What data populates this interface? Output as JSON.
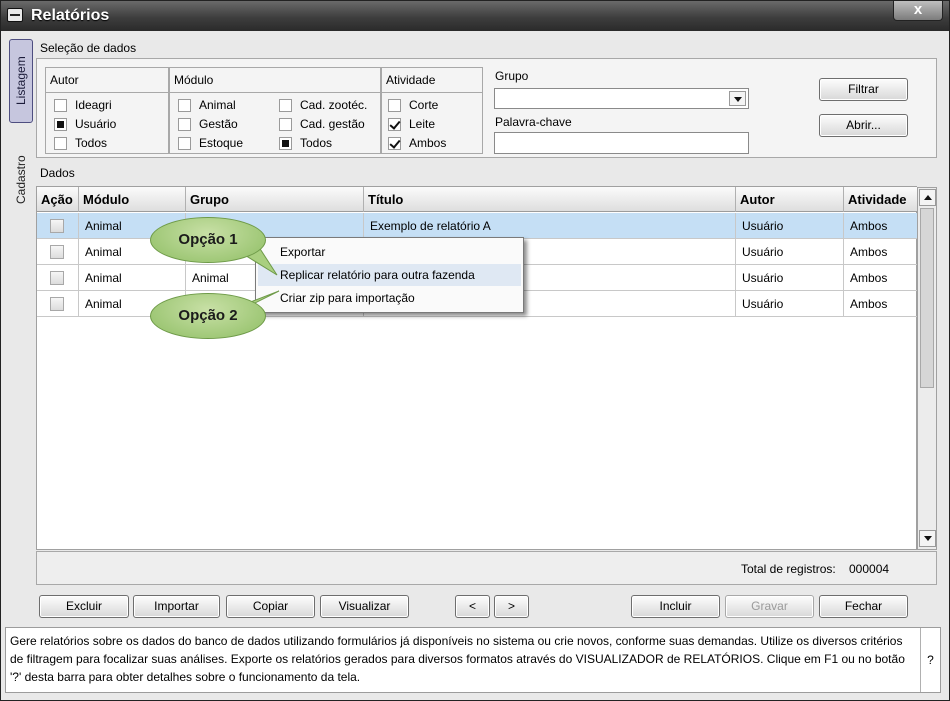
{
  "window": {
    "title": "Relatórios",
    "close_label": "x"
  },
  "side_tabs": {
    "active": "Listagem",
    "inactive": "Cadastro"
  },
  "selection": {
    "label": "Seleção de dados",
    "autor": {
      "title": "Autor",
      "options": [
        "Ideagri",
        "Usuário",
        "Todos"
      ]
    },
    "modulo": {
      "title": "Módulo",
      "col1": [
        "Animal",
        "Gestão",
        "Estoque"
      ],
      "col2": [
        "Cad. zootéc.",
        "Cad. gestão",
        "Todos"
      ]
    },
    "atividade": {
      "title": "Atividade",
      "options": [
        "Corte",
        "Leite",
        "Ambos"
      ]
    },
    "grupo_label": "Grupo",
    "grupo_value": "",
    "keyword_label": "Palavra-chave",
    "keyword_value": "",
    "filter_button": "Filtrar",
    "open_button": "Abrir..."
  },
  "data": {
    "label": "Dados",
    "columns": [
      "Ação",
      "Módulo",
      "Grupo",
      "Título",
      "Autor",
      "Atividade"
    ],
    "rows": [
      {
        "modulo": "Animal",
        "grupo": "",
        "titulo": "Exemplo de relatório A",
        "autor": "Usuário",
        "atividade": "Ambos"
      },
      {
        "modulo": "Animal",
        "grupo": "",
        "titulo": "",
        "autor": "Usuário",
        "atividade": "Ambos"
      },
      {
        "modulo": "Animal",
        "grupo": "Animal",
        "titulo": "",
        "autor": "Usuário",
        "atividade": "Ambos"
      },
      {
        "modulo": "Animal",
        "grupo": "",
        "titulo": "",
        "autor": "Usuário",
        "atividade": "Ambos"
      }
    ],
    "total_label": "Total de registros:",
    "total_value": "000004"
  },
  "context_menu": {
    "items": [
      "Exportar",
      "Replicar relatório para outra fazenda",
      "Criar zip para importação"
    ]
  },
  "callouts": {
    "option1": "Opção 1",
    "option2": "Opção 2"
  },
  "buttons": {
    "excluir": "Excluir",
    "importar": "Importar",
    "copiar": "Copiar",
    "visualizar": "Visualizar",
    "prev": "<",
    "next": ">",
    "incluir": "Incluir",
    "gravar": "Gravar",
    "fechar": "Fechar"
  },
  "help": {
    "text": "Gere relatórios sobre os dados do banco de dados utilizando formulários já disponíveis no sistema ou crie novos, conforme suas demandas. Utilize os diversos critérios de filtragem para focalizar suas análises. Exporte os relatórios gerados para diversos formatos através do VISUALIZADOR de RELATÓRIOS. Clique em F1 ou no botão '?' desta barra para obter detalhes sobre o funcionamento da tela.",
    "button": "?"
  }
}
